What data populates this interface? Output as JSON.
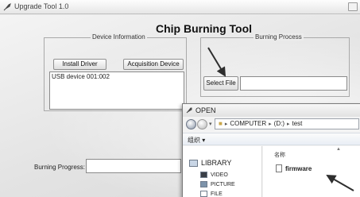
{
  "app": {
    "title": "Upgrade Tool 1.0",
    "main_title": "Chip Burning Tool",
    "device_group_label": "Device Information",
    "install_driver_label": "Install Driver",
    "acquisition_device_label": "Acquisition Device",
    "device_list": [
      "USB device 001:002"
    ],
    "process_group_label": "Burning Process",
    "select_file_label": "Select File",
    "file_path_value": "",
    "progress_label": "Burning Progress:",
    "progress_value": ""
  },
  "dialog": {
    "title": "OPEN",
    "breadcrumb": [
      "COMPUTER",
      "(D:)",
      "test"
    ],
    "organize_label": "组织 ▾",
    "nav_items": {
      "library": "LIBRARY",
      "video": "VIDEO",
      "picture": "PICTURE",
      "file": "FILE"
    },
    "column_header": "名称",
    "files": [
      "firmware"
    ]
  },
  "icons": {
    "app": "feather-icon",
    "back": "back-arrow-icon",
    "forward": "forward-arrow-icon",
    "library": "library-icon",
    "file": "document-icon"
  },
  "colors": {
    "window_bg": "#ececec",
    "pointer": "#333333",
    "address_border": "#9da3ab"
  }
}
